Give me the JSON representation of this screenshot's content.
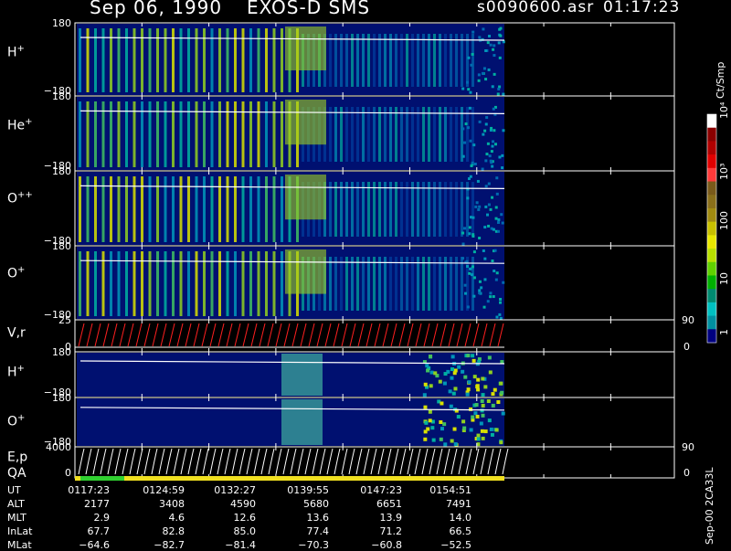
{
  "header": {
    "date": "Sep 06, 1990",
    "mission": "EXOS-D SMS",
    "file": "s0090600.asr",
    "time": "01:17:23"
  },
  "colorbar": {
    "label": "Ct/Smp",
    "ticks": [
      "10⁴",
      "10³",
      "100",
      "10",
      "1"
    ],
    "colors": [
      "#ffffff",
      "#8b0000",
      "#b00000",
      "#e00000",
      "#ff3a3a",
      "#7a5a1a",
      "#8a6f1a",
      "#a08a10",
      "#c8c000",
      "#e8e800",
      "#b8e000",
      "#60d000",
      "#00b000",
      "#008a70",
      "#00c0c0",
      "#0090a0",
      "#000080"
    ]
  },
  "panels": [
    {
      "label": "H",
      "sup": "+",
      "ytop": "180",
      "ybottom": "−180",
      "right_top": "",
      "right_bottom": ""
    },
    {
      "label": "He",
      "sup": "+",
      "ytop": "180",
      "ybottom": "−180",
      "right_top": "",
      "right_bottom": ""
    },
    {
      "label": "O",
      "sup": "++",
      "ytop": "180",
      "ybottom": "−180",
      "right_top": "",
      "right_bottom": ""
    },
    {
      "label": "O",
      "sup": "+",
      "ytop": "180",
      "ybottom": "−180",
      "right_top": "",
      "right_bottom": ""
    },
    {
      "label": "V,r",
      "sup": "",
      "ytop": "25",
      "ybottom": "0",
      "right_top": "90",
      "right_bottom": "0"
    },
    {
      "label": "H",
      "sup": "+",
      "ytop": "180",
      "ybottom": "−180",
      "right_top": "",
      "right_bottom": ""
    },
    {
      "label": "O",
      "sup": "+",
      "ytop": "180",
      "ybottom": "−180",
      "right_top": "",
      "right_bottom": ""
    },
    {
      "label": "E,p",
      "sup": "",
      "ytop": "4000",
      "ybottom": "0",
      "right_top": "90",
      "right_bottom": "0"
    }
  ],
  "qa_label": "QA",
  "side_label": "Sep-00 2CA33L",
  "ephemeris": {
    "rows": [
      {
        "name": "UT",
        "values": [
          "0117:23",
          "0124:59",
          "0132:27",
          "0139:55",
          "0147:23",
          "0154:51"
        ]
      },
      {
        "name": "ALT",
        "values": [
          "2177",
          "3408",
          "4590",
          "5680",
          "6651",
          "7491"
        ]
      },
      {
        "name": "MLT",
        "values": [
          "2.9",
          "4.6",
          "12.6",
          "13.6",
          "13.9",
          "14.0"
        ]
      },
      {
        "name": "InLat",
        "values": [
          "67.7",
          "82.8",
          "85.0",
          "77.4",
          "71.2",
          "66.5"
        ]
      },
      {
        "name": "MLat",
        "values": [
          "−64.6",
          "−82.7",
          "−81.4",
          "−70.3",
          "−60.8",
          "−52.5"
        ]
      }
    ]
  },
  "chart_data": {
    "type": "heatmap",
    "title": "Sep 06, 1990  EXOS-D SMS",
    "x": [
      "0117:23",
      "0124:59",
      "0132:27",
      "0139:55",
      "0147:23",
      "0154:51"
    ],
    "xlabel": "UT",
    "series": [
      {
        "name": "H+",
        "ylim": [
          -180,
          180
        ]
      },
      {
        "name": "He+",
        "ylim": [
          -180,
          180
        ]
      },
      {
        "name": "O++",
        "ylim": [
          -180,
          180
        ]
      },
      {
        "name": "O+",
        "ylim": [
          -180,
          180
        ]
      },
      {
        "name": "V,r",
        "ylim": [
          0,
          25
        ],
        "ylim_right": [
          0,
          90
        ]
      },
      {
        "name": "H+",
        "ylim": [
          -180,
          180
        ]
      },
      {
        "name": "O+",
        "ylim": [
          -180,
          180
        ]
      },
      {
        "name": "E,p",
        "ylim": [
          0,
          4000
        ],
        "ylim_right": [
          0,
          90
        ]
      }
    ],
    "color_scale": {
      "label": "Ct/Smp",
      "type": "log",
      "range": [
        1,
        10000
      ]
    }
  }
}
